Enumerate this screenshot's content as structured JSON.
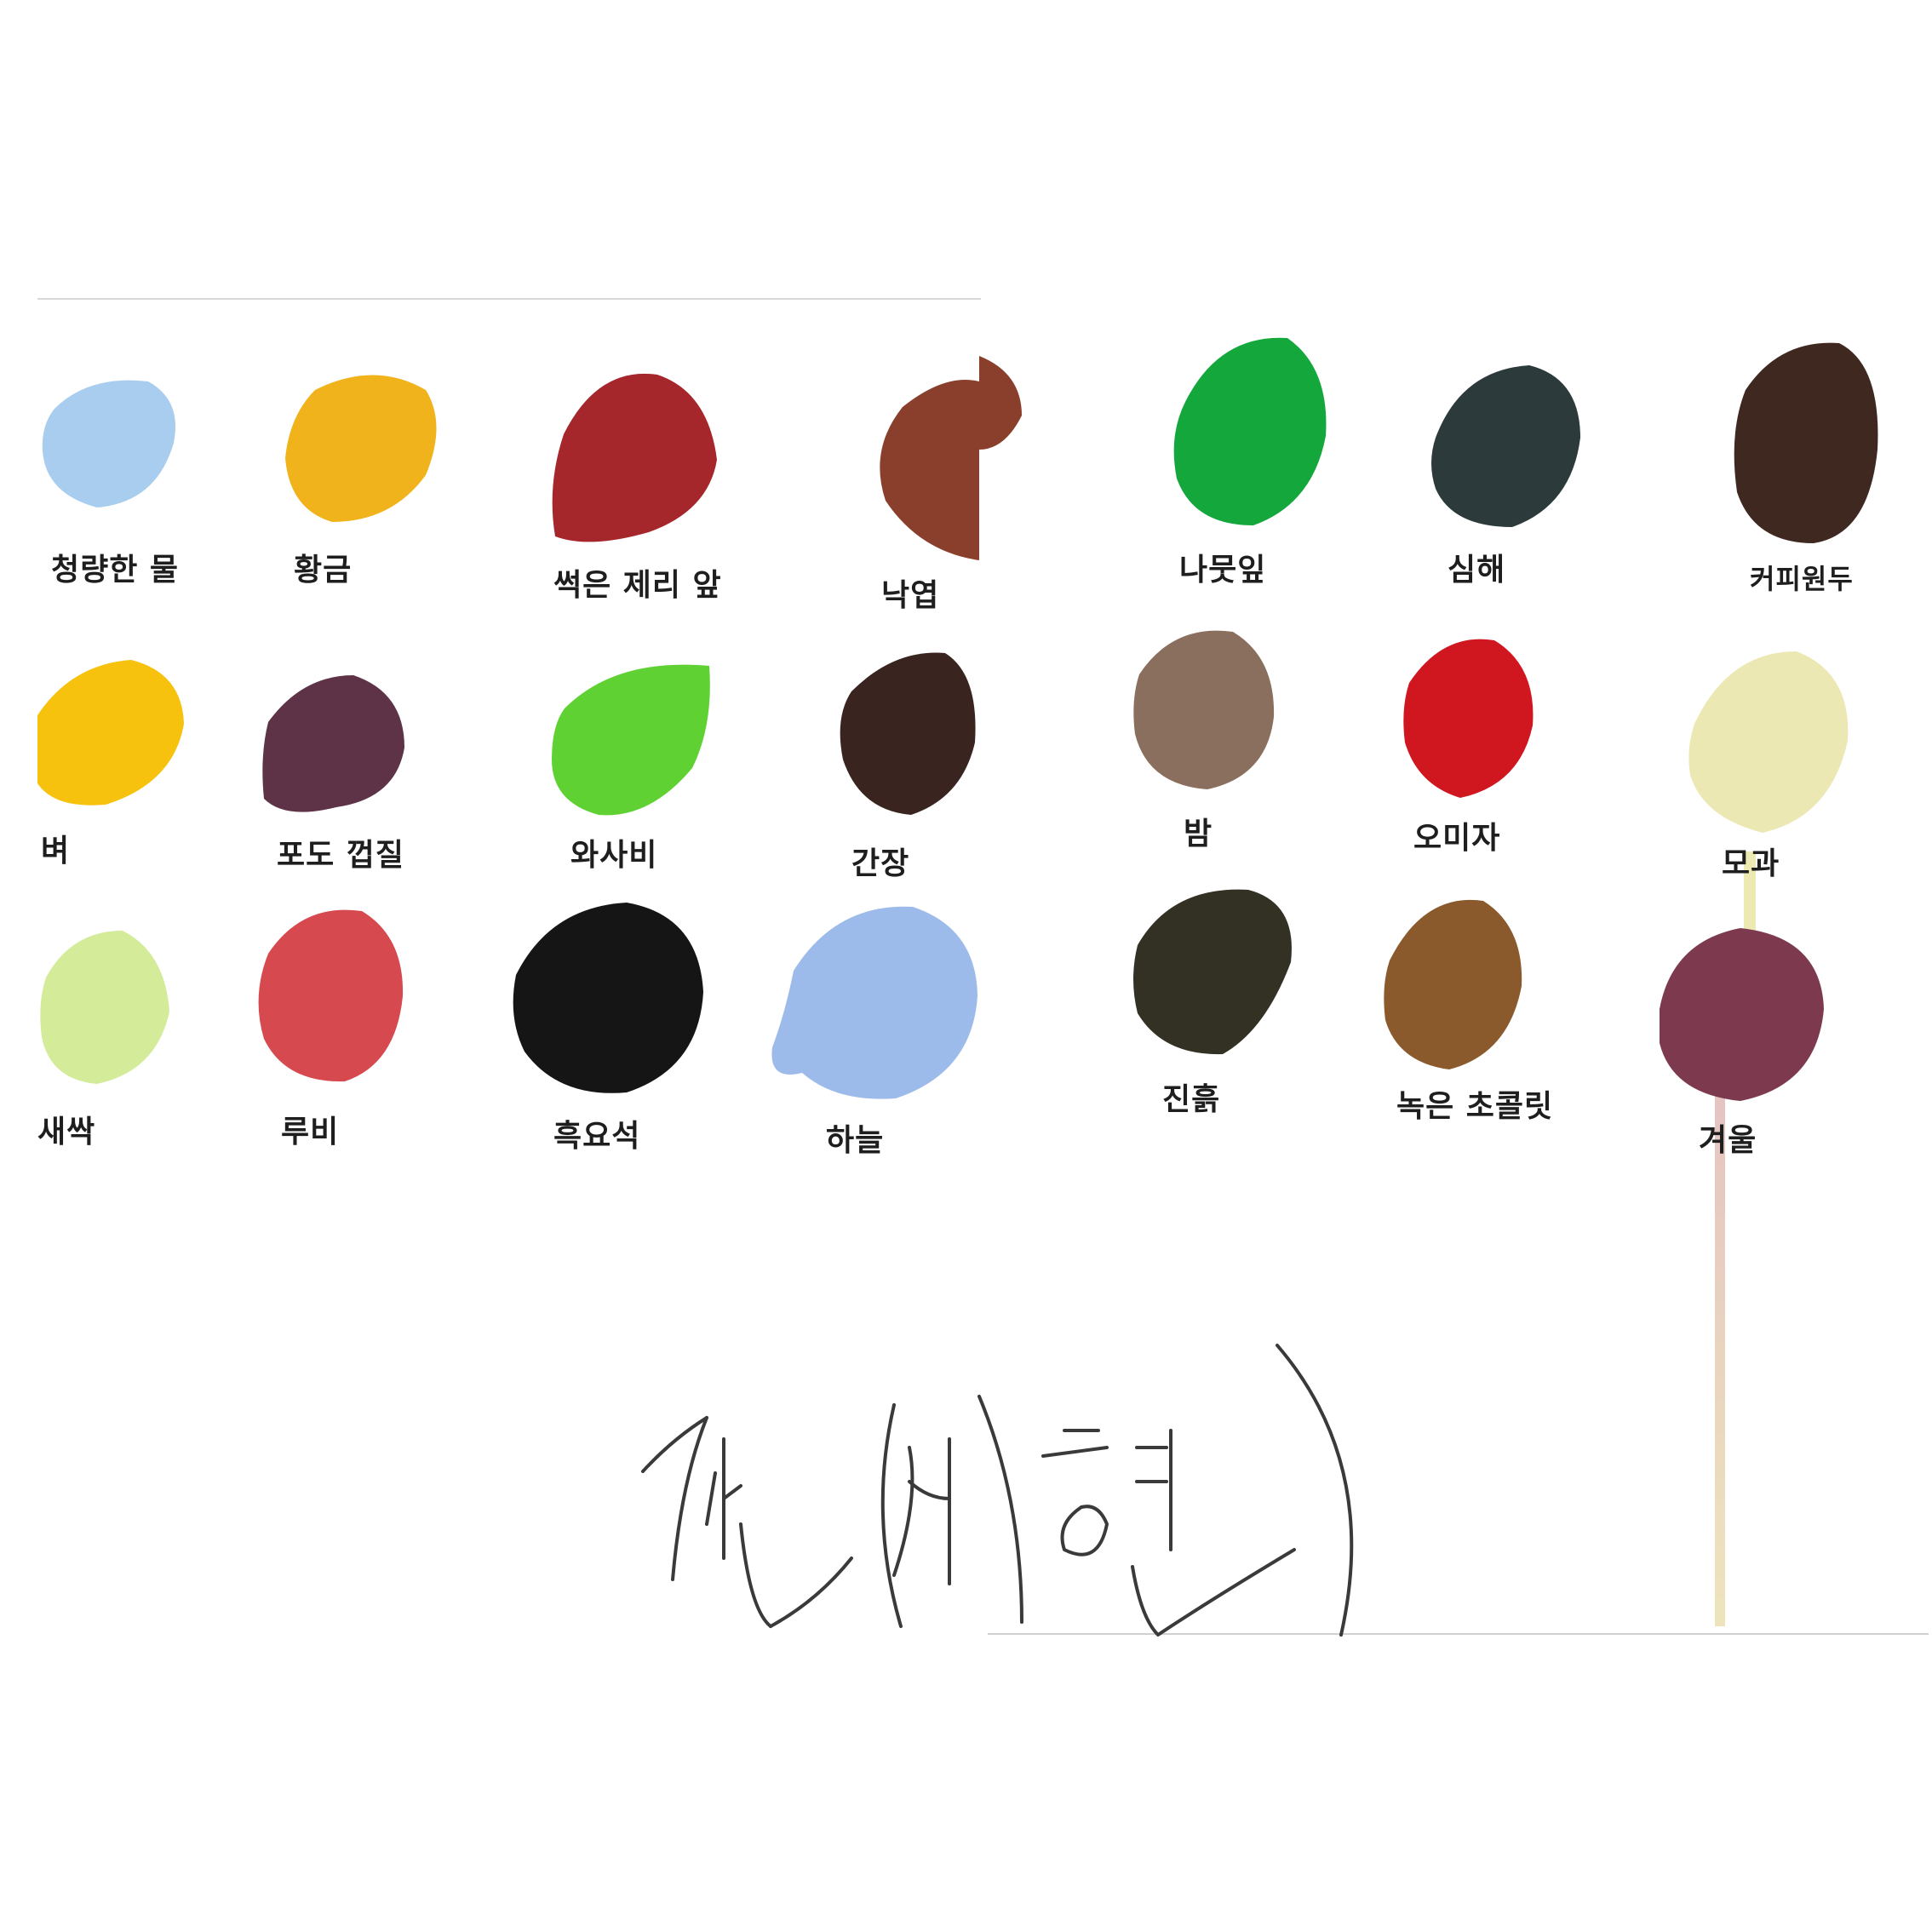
{
  "swatches": [
    {
      "label": "청량한 물",
      "color": "#a9cdee"
    },
    {
      "label": "황금",
      "color": "#f0b31c"
    },
    {
      "label": "썩은 제리 앞",
      "color": "#a5262b"
    },
    {
      "label": "낙엽",
      "color": "#8a3f2c"
    },
    {
      "label": "벼",
      "color": "#f6c20e"
    },
    {
      "label": "포도 껍질",
      "color": "#5e3347"
    },
    {
      "label": "와사비",
      "color": "#5fd133"
    },
    {
      "label": "간장",
      "color": "#3a2420"
    },
    {
      "label": "새싹",
      "color": "#d4ec9a"
    },
    {
      "label": "루비",
      "color": "#d64a4f"
    },
    {
      "label": "흑요석",
      "color": "#151515"
    },
    {
      "label": "하늘",
      "color": "#9dbbea"
    },
    {
      "label": "나뭇잎",
      "color": "#14a83c"
    },
    {
      "label": "심해",
      "color": "#2c3a3c"
    },
    {
      "label": "커피원두",
      "color": "#3f2820"
    },
    {
      "label": "밤",
      "color": "#8a6e5e"
    },
    {
      "label": "오미자",
      "color": "#d0161f"
    },
    {
      "label": "모과",
      "color": "#ece8b4"
    },
    {
      "label": "진흙",
      "color": "#333024"
    },
    {
      "label": "녹은 초콜릿",
      "color": "#8a5a2c"
    },
    {
      "label": "겨울",
      "color": "#7d3a4f"
    }
  ],
  "signature": {
    "text": "전(세)헌"
  }
}
